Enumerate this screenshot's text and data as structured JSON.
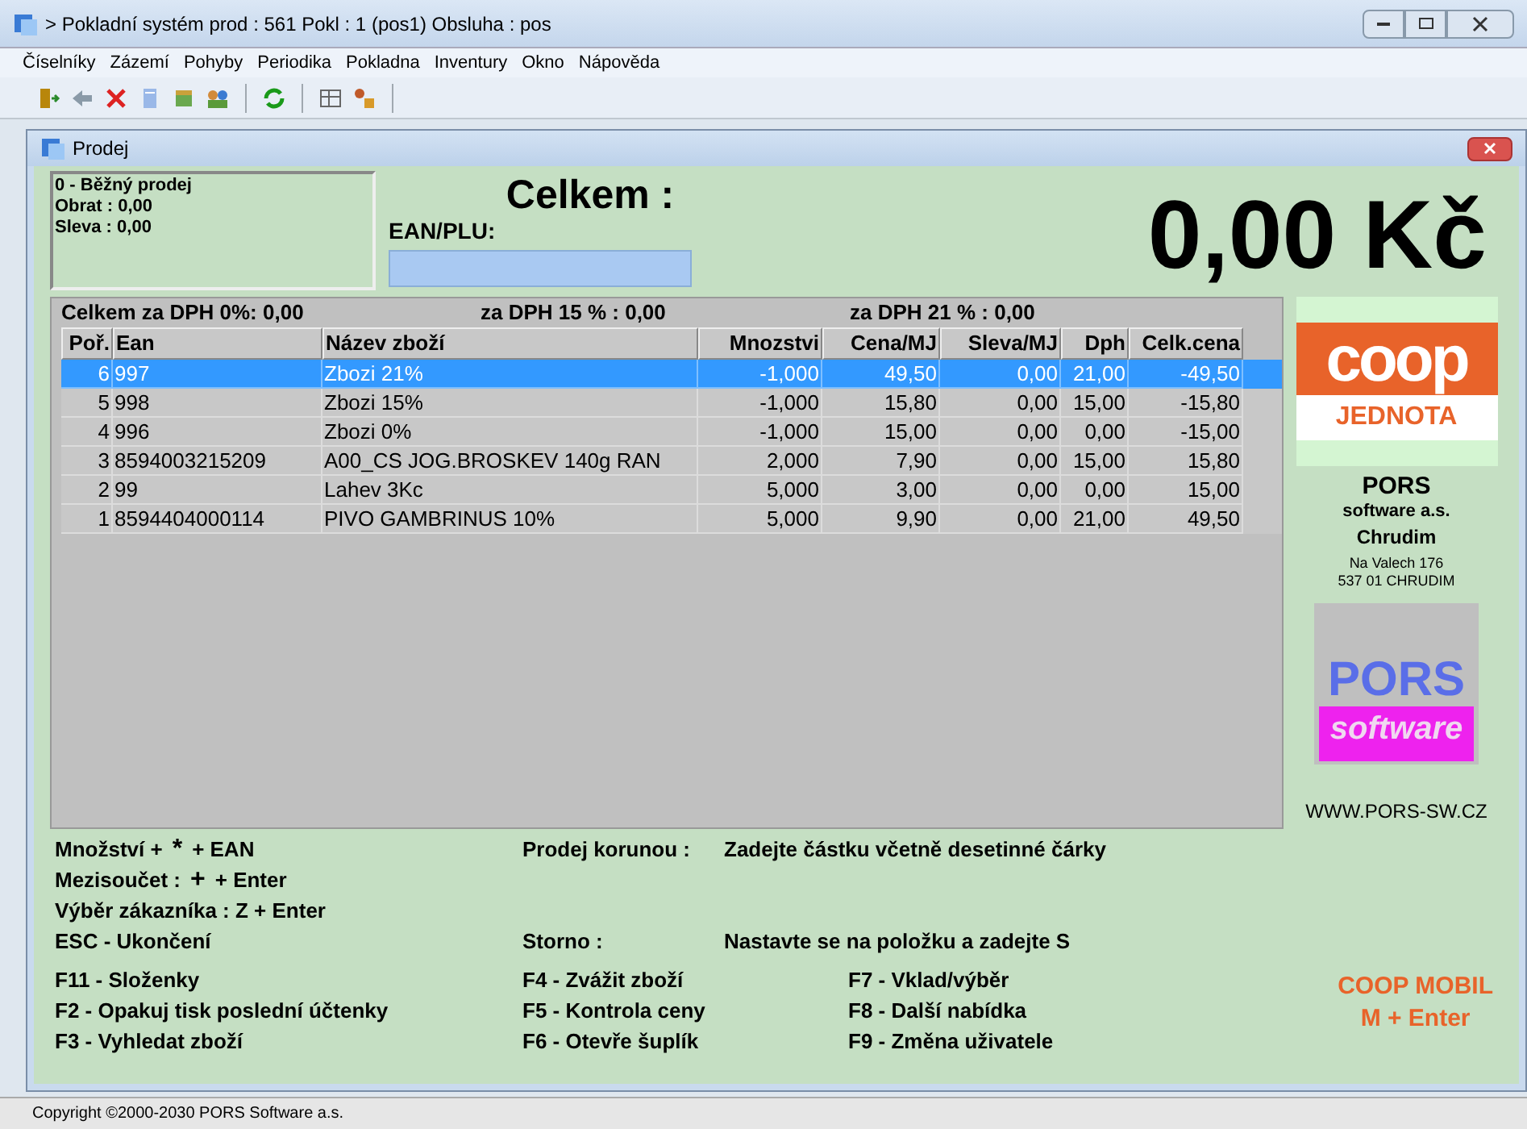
{
  "window": {
    "title": "> Pokladní systém prod : 561 Pokl : 1 (pos1) Obsluha : pos"
  },
  "menu": [
    "Číselníky",
    "Zázemí",
    "Pohyby",
    "Periodika",
    "Pokladna",
    "Inventury",
    "Okno",
    "Nápověda"
  ],
  "child_window": {
    "title": "Prodej"
  },
  "info": [
    "0 - Běžný prodej",
    "Obrat : 0,00",
    "Sleva : 0,00"
  ],
  "total_label": "Celkem :",
  "ean_label": "EAN/PLU:",
  "total_amount": "0,00 Kč",
  "vat_summary": [
    "Celkem za DPH 0%: 0,00",
    "za DPH 15 % : 0,00",
    "za DPH 21 % : 0,00"
  ],
  "table": {
    "columns": [
      "Poř.",
      "Ean",
      "Název zboží",
      "Mnozstvi",
      "Cena/MJ",
      "Sleva/MJ",
      "Dph",
      "Celk.cena"
    ],
    "rows": [
      {
        "cells": [
          "6",
          "997",
          "Zbozi 21%",
          "-1,000",
          "49,50",
          "0,00",
          "21,00",
          "-49,50"
        ],
        "selected": true
      },
      {
        "cells": [
          "5",
          "998",
          "Zbozi 15%",
          "-1,000",
          "15,80",
          "0,00",
          "15,00",
          "-15,80"
        ],
        "selected": false
      },
      {
        "cells": [
          "4",
          "996",
          "Zbozi 0%",
          "-1,000",
          "15,00",
          "0,00",
          "0,00",
          "-15,00"
        ],
        "selected": false
      },
      {
        "cells": [
          "3",
          "8594003215209",
          "A00_CS JOG.BROSKEV 140g RAN",
          "2,000",
          "7,90",
          "0,00",
          "15,00",
          "15,80"
        ],
        "selected": false
      },
      {
        "cells": [
          "2",
          "99",
          "Lahev 3Kc",
          "5,000",
          "3,00",
          "0,00",
          "0,00",
          "15,00"
        ],
        "selected": false
      },
      {
        "cells": [
          "1",
          "8594404000114",
          "PIVO GAMBRINUS 10%",
          "5,000",
          "9,90",
          "0,00",
          "21,00",
          "49,50"
        ],
        "selected": false
      }
    ]
  },
  "vendor": {
    "coop_logo": "coop",
    "coop_sub": "JEDNOTA",
    "name": "PORS",
    "company": "software a.s.",
    "city": "Chrudim",
    "address": [
      "Na Valech 176",
      "537 01 CHRUDIM"
    ],
    "logo_top": "PORS",
    "logo_bottom": "software",
    "url": "WWW.PORS-SW.CZ"
  },
  "shortcuts_left": [
    [
      "Množství +",
      "*",
      "+ EAN"
    ],
    [
      "Mezisoučet :",
      "+",
      "+ Enter"
    ],
    [
      "Výběr zákazníka : Z + Enter"
    ],
    [
      "ESC - Ukončení"
    ]
  ],
  "hints": [
    {
      "label": "Prodej korunou :",
      "text": "Zadejte částku včetně desetinné čárky"
    },
    {
      "label": "Storno :",
      "text": "Nastavte se na položku a zadejte S"
    }
  ],
  "function_keys": [
    [
      "F11 - Složenky",
      "F2 - Opakuj tisk poslední účtenky",
      "F3 - Vyhledat zboží"
    ],
    [
      "F4 - Zvážit zboží",
      "F5 - Kontrola ceny",
      "F6 - Otevře šuplík"
    ],
    [
      "F7 - Vklad/výběr",
      "F8 - Další nabídka",
      "F9 - Změna uživatele"
    ]
  ],
  "coop_mobil": [
    "COOP MOBIL",
    "M + Enter"
  ],
  "status_bar": "Copyright ©2000-2030 PORS Software a.s."
}
